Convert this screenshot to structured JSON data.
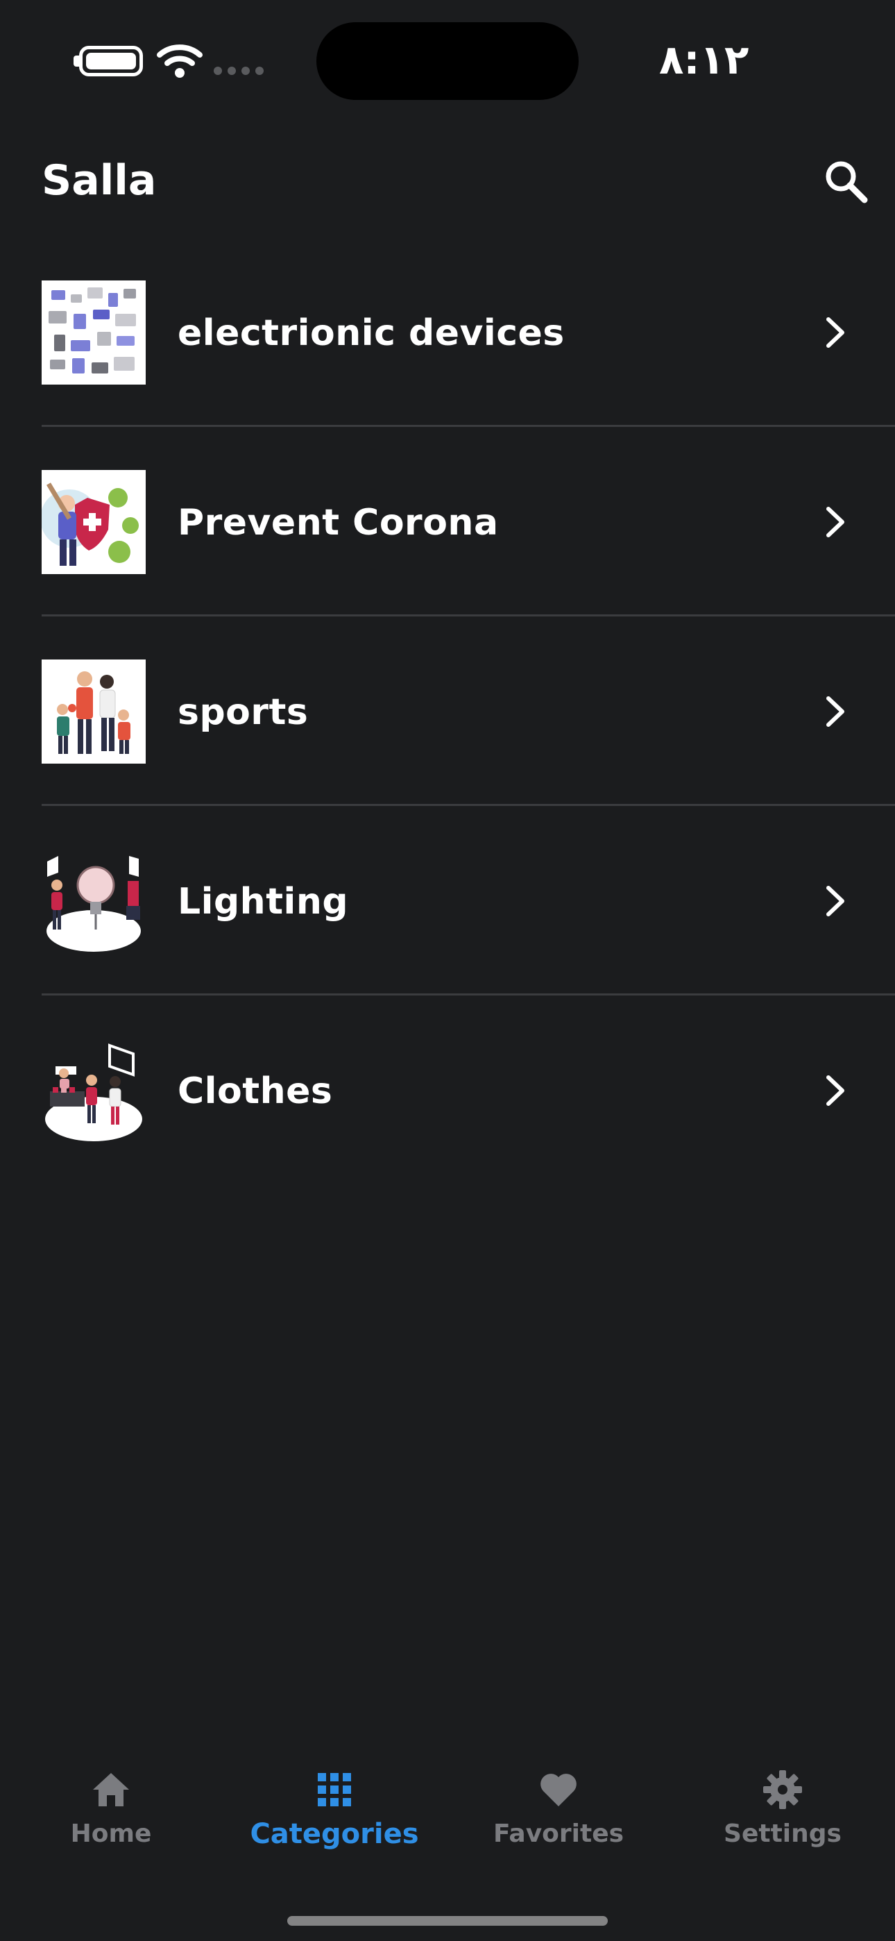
{
  "status_bar": {
    "time": "٨:١٢",
    "icons": [
      "battery-icon",
      "wifi-icon",
      "cellular-signal-icon"
    ]
  },
  "header": {
    "title": "Salla",
    "search_icon": "search-icon"
  },
  "categories": [
    {
      "label": "electrionic devices",
      "thumbnail": "electronics-illustration"
    },
    {
      "label": "Prevent Corona",
      "thumbnail": "corona-prevention-illustration"
    },
    {
      "label": "sports",
      "thumbnail": "family-sports-illustration"
    },
    {
      "label": "Lighting",
      "thumbnail": "lightbulb-illustration"
    },
    {
      "label": "Clothes",
      "thumbnail": "clothes-shop-illustration"
    }
  ],
  "tab_bar": {
    "active_tab": "Categories",
    "tabs": [
      {
        "label": "Home",
        "icon": "home-icon"
      },
      {
        "label": "Categories",
        "icon": "grid-icon"
      },
      {
        "label": "Favorites",
        "icon": "heart-icon"
      },
      {
        "label": "Settings",
        "icon": "gear-icon"
      }
    ]
  },
  "colors": {
    "background": "#1b1c1e",
    "accent": "#2f8fe6",
    "inactive": "#7b7c80",
    "divider": "#3b3c3f"
  }
}
